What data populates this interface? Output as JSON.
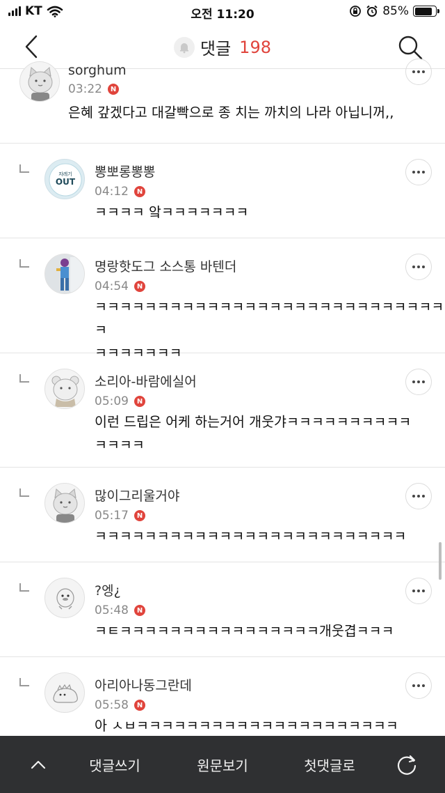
{
  "status_bar": {
    "carrier": "KT",
    "time": "오전 11:20",
    "battery": "85%",
    "battery_level": 0.85
  },
  "header": {
    "title": "댓글",
    "count": "198"
  },
  "comments": [
    {
      "nick": "sorghum",
      "time": "03:22",
      "badge": "N",
      "text": "은혜 갚겠다고 대갈빡으로 종 치는 까치의 나라 아닙니꺼,,",
      "reply": false,
      "avatar": "cat-avatar"
    },
    {
      "nick": "뽕뽀롱뽕뽕",
      "time": "04:12",
      "badge": "N",
      "text": "ㅋㅋㅋㅋ 앜ㅋㅋㅋㅋㅋㅋㅋ",
      "reply": true,
      "avatar": "out-avatar",
      "avatar_text_top": "자레기",
      "avatar_text_main": "OUT"
    },
    {
      "nick": "명랑핫도그 소스통 바텐더",
      "time": "04:54",
      "badge": "N",
      "text": "ㅋㅋㅋㅋㅋㅋㅋㅋㅋㅋㅋㅋㅋㅋㅋㅋㅋㅋㅋㅋㅋㅋㅋㅋㅋㅋㅋㅋㅋ\nㅋㅋㅋㅋㅋㅋㅋ",
      "reply": true,
      "avatar": "photo-avatar"
    },
    {
      "nick": "소리아-바람에실어",
      "time": "05:09",
      "badge": "N",
      "text": "이런 드립은 어케 하는거어 개웃갸ㅋㅋㅋㅋㅋㅋㅋㅋㅋㅋ\nㅋㅋㅋㅋ",
      "reply": true,
      "avatar": "bear-avatar"
    },
    {
      "nick": "많이그리울거야",
      "time": "05:17",
      "badge": "N",
      "text": "ㅋㅋㅋㅋㅋㅋㅋㅋㅋㅋㅋㅋㅋㅋㅋㅋㅋㅋㅋㅋㅋㅋㅋㅋㅋ",
      "reply": true,
      "avatar": "cat-avatar"
    },
    {
      "nick": "?엥¿",
      "time": "05:48",
      "badge": "N",
      "text": "ㅋㅌㅋㅋㅋㅋㅋㅋㅋㅋㅋㅋㅋㅋㅋㅋㅋㅋ개웃겹ㅋㅋㅋ",
      "reply": true,
      "avatar": "duck-avatar"
    },
    {
      "nick": "아리아나동그란데",
      "time": "05:58",
      "badge": "N",
      "text": "아 ㅅㅂㅋㅋㅋㅋㅋㅋㅋㅋㅋㅋㅋㅋㅋㅋㅋㅋㅋㅋㅋㅋㅋ",
      "reply": true,
      "avatar": "dino-avatar"
    }
  ],
  "bottom_bar": {
    "up_icon": "chevron-up-icon",
    "write": "댓글쓰기",
    "original": "원문보기",
    "first": "첫댓글로",
    "refresh_icon": "refresh-icon"
  }
}
